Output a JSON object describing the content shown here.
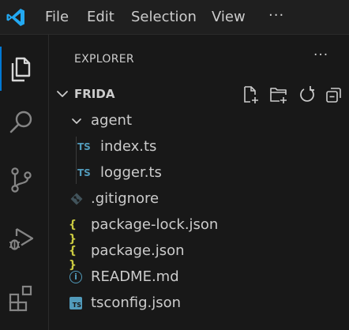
{
  "menu": {
    "items": [
      "File",
      "Edit",
      "Selection",
      "View"
    ],
    "more": "···"
  },
  "activity_bar": {
    "items": [
      "explorer-icon",
      "search-icon",
      "source-control-icon",
      "run-debug-icon",
      "extensions-icon"
    ],
    "active": "explorer-icon",
    "accent": "#0078d4"
  },
  "explorer": {
    "title": "EXPLORER",
    "more": "···",
    "folder": {
      "name": "FRIDA",
      "expanded": true,
      "actions": [
        "new-file-icon",
        "new-folder-icon",
        "refresh-icon",
        "collapse-all-icon"
      ]
    },
    "tree": [
      {
        "label": "agent",
        "type": "folder",
        "expanded": true,
        "depth": 1
      },
      {
        "label": "index.ts",
        "type": "ts",
        "depth": 2,
        "icon_text": "TS"
      },
      {
        "label": "logger.ts",
        "type": "ts",
        "depth": 2,
        "icon_text": "TS"
      },
      {
        "label": ".gitignore",
        "type": "git",
        "depth": 1
      },
      {
        "label": "package-lock.json",
        "type": "json",
        "depth": 1,
        "icon_text": "{ }"
      },
      {
        "label": "package.json",
        "type": "json",
        "depth": 1,
        "icon_text": "{ }"
      },
      {
        "label": "README.md",
        "type": "info",
        "depth": 1,
        "icon_text": "i"
      },
      {
        "label": "tsconfig.json",
        "type": "tsconfig",
        "depth": 1,
        "icon_text": "TS"
      }
    ],
    "colors": {
      "ts": "#519aba",
      "json": "#cbcb41",
      "info": "#519aba",
      "git": "#41535b"
    }
  }
}
